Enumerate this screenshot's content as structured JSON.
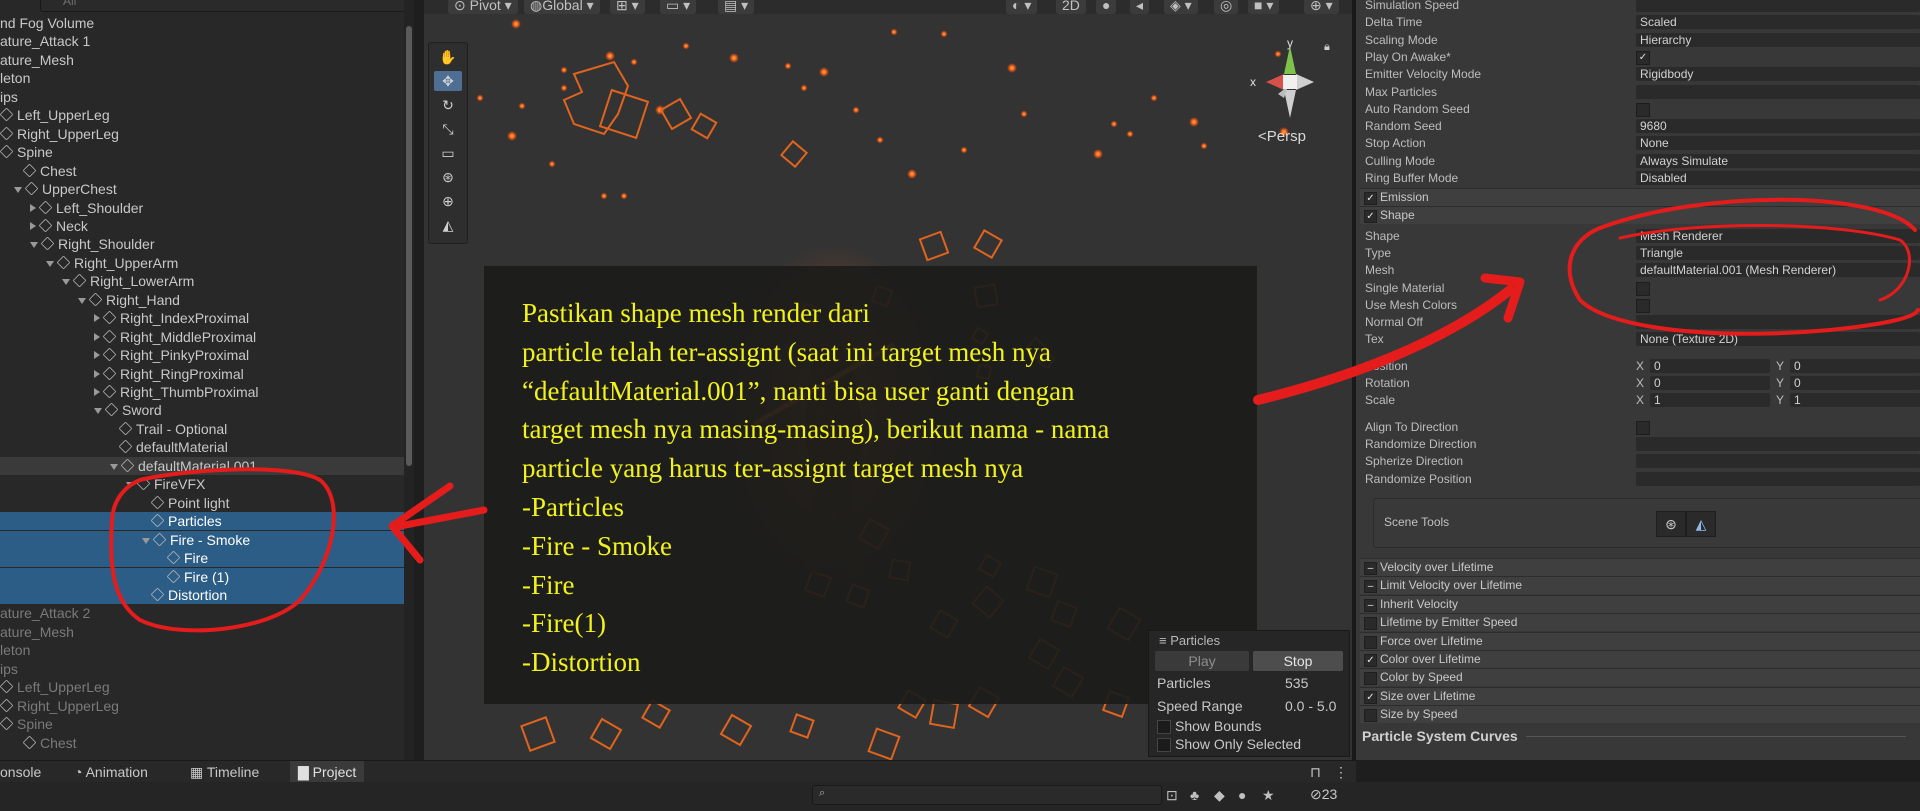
{
  "hierarchy": {
    "search_placeholder": "All",
    "rows": [
      {
        "label": "nd Fog Volume",
        "indent": 0,
        "arrow": "",
        "icon": false,
        "style": ""
      },
      {
        "label": "ature_Attack 1",
        "indent": 0,
        "arrow": "",
        "icon": false,
        "style": ""
      },
      {
        "label": "ature_Mesh",
        "indent": 0,
        "arrow": "",
        "icon": false,
        "style": ""
      },
      {
        "label": "leton",
        "indent": 0,
        "arrow": "",
        "icon": false,
        "style": ""
      },
      {
        "label": "ips",
        "indent": 0,
        "arrow": "",
        "icon": false,
        "style": ""
      },
      {
        "label": "Left_UpperLeg",
        "indent": 0,
        "arrow": "",
        "icon": true,
        "style": ""
      },
      {
        "label": "Right_UpperLeg",
        "indent": 0,
        "arrow": "",
        "icon": true,
        "style": ""
      },
      {
        "label": "Spine",
        "indent": 0,
        "arrow": "",
        "icon": true,
        "style": ""
      },
      {
        "label": "Chest",
        "indent": 1,
        "arrow": "",
        "icon": true,
        "style": ""
      },
      {
        "label": "UpperChest",
        "indent": 1,
        "arrow": "d",
        "icon": true,
        "style": ""
      },
      {
        "label": "Left_Shoulder",
        "indent": 2,
        "arrow": "r",
        "icon": true,
        "style": ""
      },
      {
        "label": "Neck",
        "indent": 2,
        "arrow": "r",
        "icon": true,
        "style": ""
      },
      {
        "label": "Right_Shoulder",
        "indent": 2,
        "arrow": "d",
        "icon": true,
        "style": ""
      },
      {
        "label": "Right_UpperArm",
        "indent": 3,
        "arrow": "d",
        "icon": true,
        "style": ""
      },
      {
        "label": "Right_LowerArm",
        "indent": 4,
        "arrow": "d",
        "icon": true,
        "style": ""
      },
      {
        "label": "Right_Hand",
        "indent": 5,
        "arrow": "d",
        "icon": true,
        "style": ""
      },
      {
        "label": "Right_IndexProximal",
        "indent": 6,
        "arrow": "r",
        "icon": true,
        "style": ""
      },
      {
        "label": "Right_MiddleProximal",
        "indent": 6,
        "arrow": "r",
        "icon": true,
        "style": ""
      },
      {
        "label": "Right_PinkyProximal",
        "indent": 6,
        "arrow": "r",
        "icon": true,
        "style": ""
      },
      {
        "label": "Right_RingProximal",
        "indent": 6,
        "arrow": "r",
        "icon": true,
        "style": ""
      },
      {
        "label": "Right_ThumbProximal",
        "indent": 6,
        "arrow": "r",
        "icon": true,
        "style": ""
      },
      {
        "label": "Sword",
        "indent": 6,
        "arrow": "d",
        "icon": true,
        "style": ""
      },
      {
        "label": "Trail - Optional",
        "indent": 7,
        "arrow": "",
        "icon": true,
        "style": ""
      },
      {
        "label": "defaultMaterial",
        "indent": 7,
        "arrow": "",
        "icon": true,
        "style": ""
      },
      {
        "label": "defaultMaterial.001",
        "indent": 7,
        "arrow": "d",
        "icon": true,
        "style": "hi"
      },
      {
        "label": "FireVFX",
        "indent": 8,
        "arrow": "d",
        "icon": true,
        "style": ""
      },
      {
        "label": "Point light",
        "indent": 9,
        "arrow": "",
        "icon": true,
        "style": ""
      },
      {
        "label": "Particles",
        "indent": 9,
        "arrow": "",
        "icon": true,
        "style": "sel"
      },
      {
        "label": "Fire - Smoke",
        "indent": 9,
        "arrow": "d",
        "icon": true,
        "style": "sel"
      },
      {
        "label": "Fire",
        "indent": 10,
        "arrow": "",
        "icon": true,
        "style": "sel"
      },
      {
        "label": "Fire (1)",
        "indent": 10,
        "arrow": "",
        "icon": true,
        "style": "sel"
      },
      {
        "label": "Distortion",
        "indent": 9,
        "arrow": "",
        "icon": true,
        "style": "sel"
      },
      {
        "label": "ature_Attack 2",
        "indent": 0,
        "arrow": "",
        "icon": false,
        "style": "dim"
      },
      {
        "label": "ature_Mesh",
        "indent": 0,
        "arrow": "",
        "icon": false,
        "style": "dim"
      },
      {
        "label": "leton",
        "indent": 0,
        "arrow": "",
        "icon": false,
        "style": "dim"
      },
      {
        "label": "ips",
        "indent": 0,
        "arrow": "",
        "icon": false,
        "style": "dim"
      },
      {
        "label": "Left_UpperLeg",
        "indent": 0,
        "arrow": "",
        "icon": true,
        "style": "dim"
      },
      {
        "label": "Right_UpperLeg",
        "indent": 0,
        "arrow": "",
        "icon": true,
        "style": "dim"
      },
      {
        "label": "Spine",
        "indent": 0,
        "arrow": "",
        "icon": true,
        "style": "dim"
      },
      {
        "label": "Chest",
        "indent": 1,
        "arrow": "",
        "icon": true,
        "style": "dim"
      }
    ]
  },
  "scene_toolbar": {
    "pivot": "Pivot",
    "global": "Global",
    "mode_2d": "2D"
  },
  "scene": {
    "persp_label": "Persp",
    "gizmo_y": "y",
    "gizmo_x": "x",
    "annotation_lines": [
      "Pastikan shape mesh render dari",
      "particle telah ter-assignt (saat ini target mesh nya",
      "“defaultMaterial.001”, nanti bisa user ganti dengan",
      "target mesh nya masing-masing), berikut nama - nama",
      "particle yang harus ter-assignt target mesh nya",
      "-Particles",
      "-Fire - Smoke",
      "-Fire",
      "-Fire(1)",
      "-Distortion"
    ],
    "annotation_color": "#f2f21c",
    "markup_color": "#e51c1c"
  },
  "particle_panel": {
    "title": "Particles",
    "play": "Play",
    "stop": "Stop",
    "particles_label": "Particles",
    "particles_value": "535",
    "speed_label": "Speed Range",
    "speed_value": "0.0 - 5.0",
    "show_bounds": "Show Bounds",
    "show_only_selected": "Show Only Selected"
  },
  "inspector": {
    "main_rows": [
      {
        "label": "Simulation Speed",
        "value": "",
        "type": "field"
      },
      {
        "label": "Delta Time",
        "value": "Scaled",
        "type": "field"
      },
      {
        "label": "Scaling Mode",
        "value": "Hierarchy",
        "type": "field"
      },
      {
        "label": "Play On Awake*",
        "value": "✓",
        "type": "check"
      },
      {
        "label": "Emitter Velocity Mode",
        "value": "Rigidbody",
        "type": "field"
      },
      {
        "label": "Max Particles",
        "value": "",
        "type": "field"
      },
      {
        "label": "Auto Random Seed",
        "value": "",
        "type": "check"
      },
      {
        "label": "Random Seed",
        "value": "9680",
        "type": "field"
      },
      {
        "label": "Stop Action",
        "value": "None",
        "type": "field"
      },
      {
        "label": "Culling Mode",
        "value": "Always Simulate",
        "type": "field"
      },
      {
        "label": "Ring Buffer Mode",
        "value": "Disabled",
        "type": "field"
      }
    ],
    "emission_label": "Emission",
    "shape_label": "Shape",
    "shape_rows": [
      {
        "label": "Shape",
        "value": "Mesh Renderer",
        "type": "field"
      },
      {
        "label": "Type",
        "value": "Triangle",
        "type": "field"
      },
      {
        "label": "Mesh",
        "value": "defaultMaterial.001 (Mesh Renderer)",
        "type": "field"
      },
      {
        "label": "Single Material",
        "value": "",
        "type": "check"
      },
      {
        "label": "Use Mesh Colors",
        "value": "",
        "type": "check"
      },
      {
        "label": "Normal Off",
        "value": "",
        "type": "field"
      },
      {
        "label": "Tex",
        "value": "None (Texture 2D)",
        "type": "field"
      }
    ],
    "transform_rows": [
      {
        "label": "Position",
        "x": "0",
        "y": "0"
      },
      {
        "label": "Rotation",
        "x": "0",
        "y": "0"
      },
      {
        "label": "Scale",
        "x": "1",
        "y": "1"
      }
    ],
    "x_label": "X",
    "y_label": "Y",
    "direction_rows": [
      {
        "label": "Align To Direction",
        "value": "",
        "type": "check"
      },
      {
        "label": "Randomize Direction",
        "value": "",
        "type": "field"
      },
      {
        "label": "Spherize Direction",
        "value": "",
        "type": "field"
      },
      {
        "label": "Randomize Position",
        "value": "",
        "type": "field"
      }
    ],
    "scene_tools_label": "Scene Tools",
    "modules": [
      {
        "label": "Velocity over Lifetime",
        "mark": "–"
      },
      {
        "label": "Limit Velocity over Lifetime",
        "mark": "–"
      },
      {
        "label": "Inherit Velocity",
        "mark": "–"
      },
      {
        "label": "Lifetime by Emitter Speed",
        "mark": ""
      },
      {
        "label": "Force over Lifetime",
        "mark": ""
      },
      {
        "label": "Color over Lifetime",
        "mark": "✓"
      },
      {
        "label": "Color by Speed",
        "mark": ""
      },
      {
        "label": "Size over Lifetime",
        "mark": "✓"
      },
      {
        "label": "Size by Speed",
        "mark": ""
      }
    ],
    "curves_label": "Particle System Curves"
  },
  "bottom": {
    "tabs": [
      "onsole",
      "Animation",
      "Timeline",
      "Project"
    ],
    "hidden_count": "23"
  }
}
